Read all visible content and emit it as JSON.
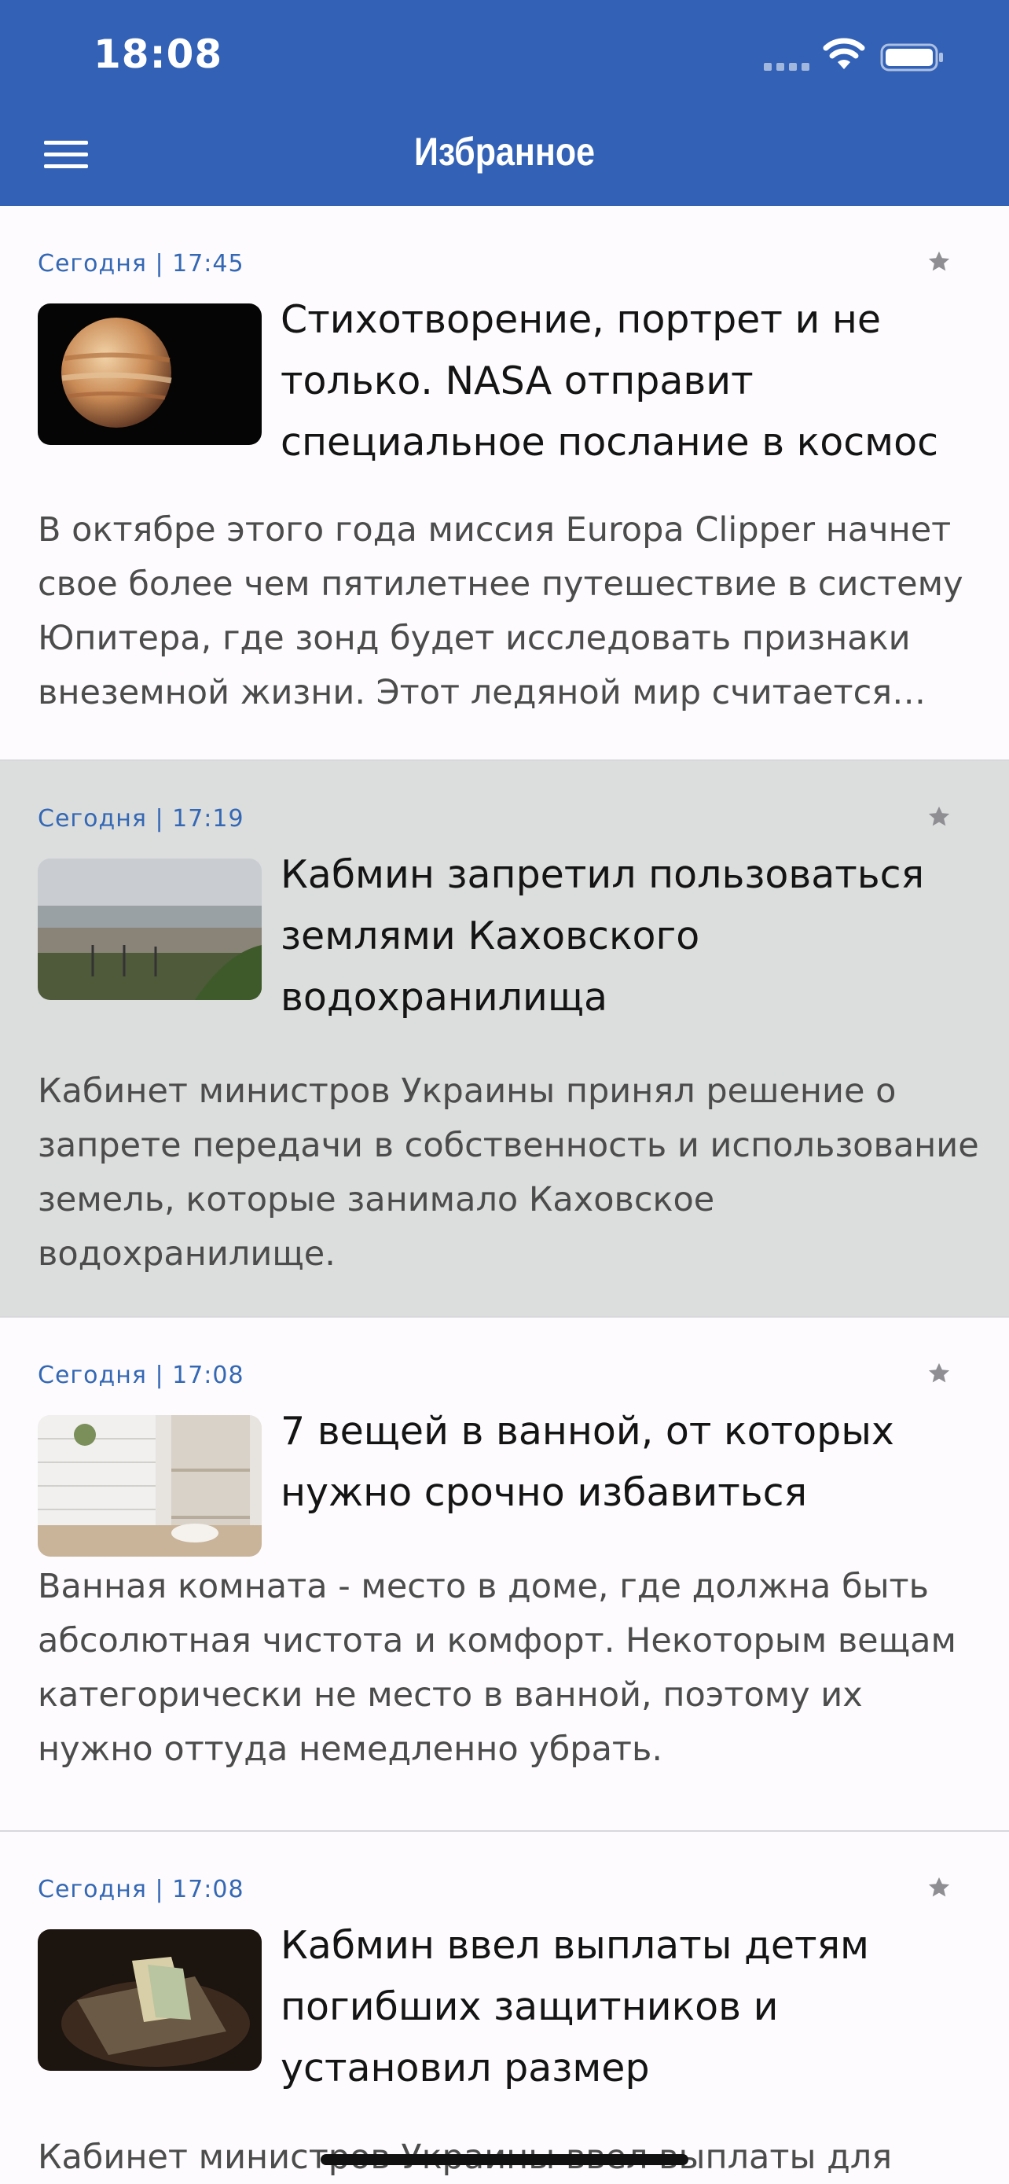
{
  "status_bar": {
    "time": "18:08"
  },
  "header": {
    "title": "Избранное"
  },
  "articles": [
    {
      "date": "Сегодня | 17:45",
      "title": "Стихотворение, портрет и не только. NASA отправит специальное послание в космос",
      "lead": "В октябре этого года миссия Europa Clipper начнет свое более чем пятилетнее путешествие в систему Юпитера, где зонд будет исследовать признаки внеземной жизни. Этот ледяной мир считается одним из самых перспективных",
      "thumb": "jupiter-planet"
    },
    {
      "date": "Сегодня | 17:19",
      "title": "Кабмин запретил пользоваться землями Каховского водохранилища",
      "lead": "Кабинет министров Украины принял решение о запрете передачи в собственность и использование земель, которые занимало Каховское водохранилище.",
      "thumb": "dried-reservoir"
    },
    {
      "date": "Сегодня | 17:08",
      "title": "7 вещей в ванной, от которых нужно срочно избавиться",
      "lead": "Ванная комната - место в доме, где должна быть абсолютная чистота и комфорт. Некоторым вещам категорически не место в ванной, поэтому их нужно оттуда немедленно убрать.",
      "thumb": "bathroom-shelf"
    },
    {
      "date": "Сегодня | 17:08",
      "title": "Кабмин ввел выплаты детям погибших защитников и установил размер",
      "lead": "Кабинет министров Украины ввел выплаты для",
      "thumb": "wallet-money"
    }
  ],
  "colors": {
    "header": "#3261b6",
    "date": "#3468b4",
    "highlight": "#dcdddd"
  }
}
